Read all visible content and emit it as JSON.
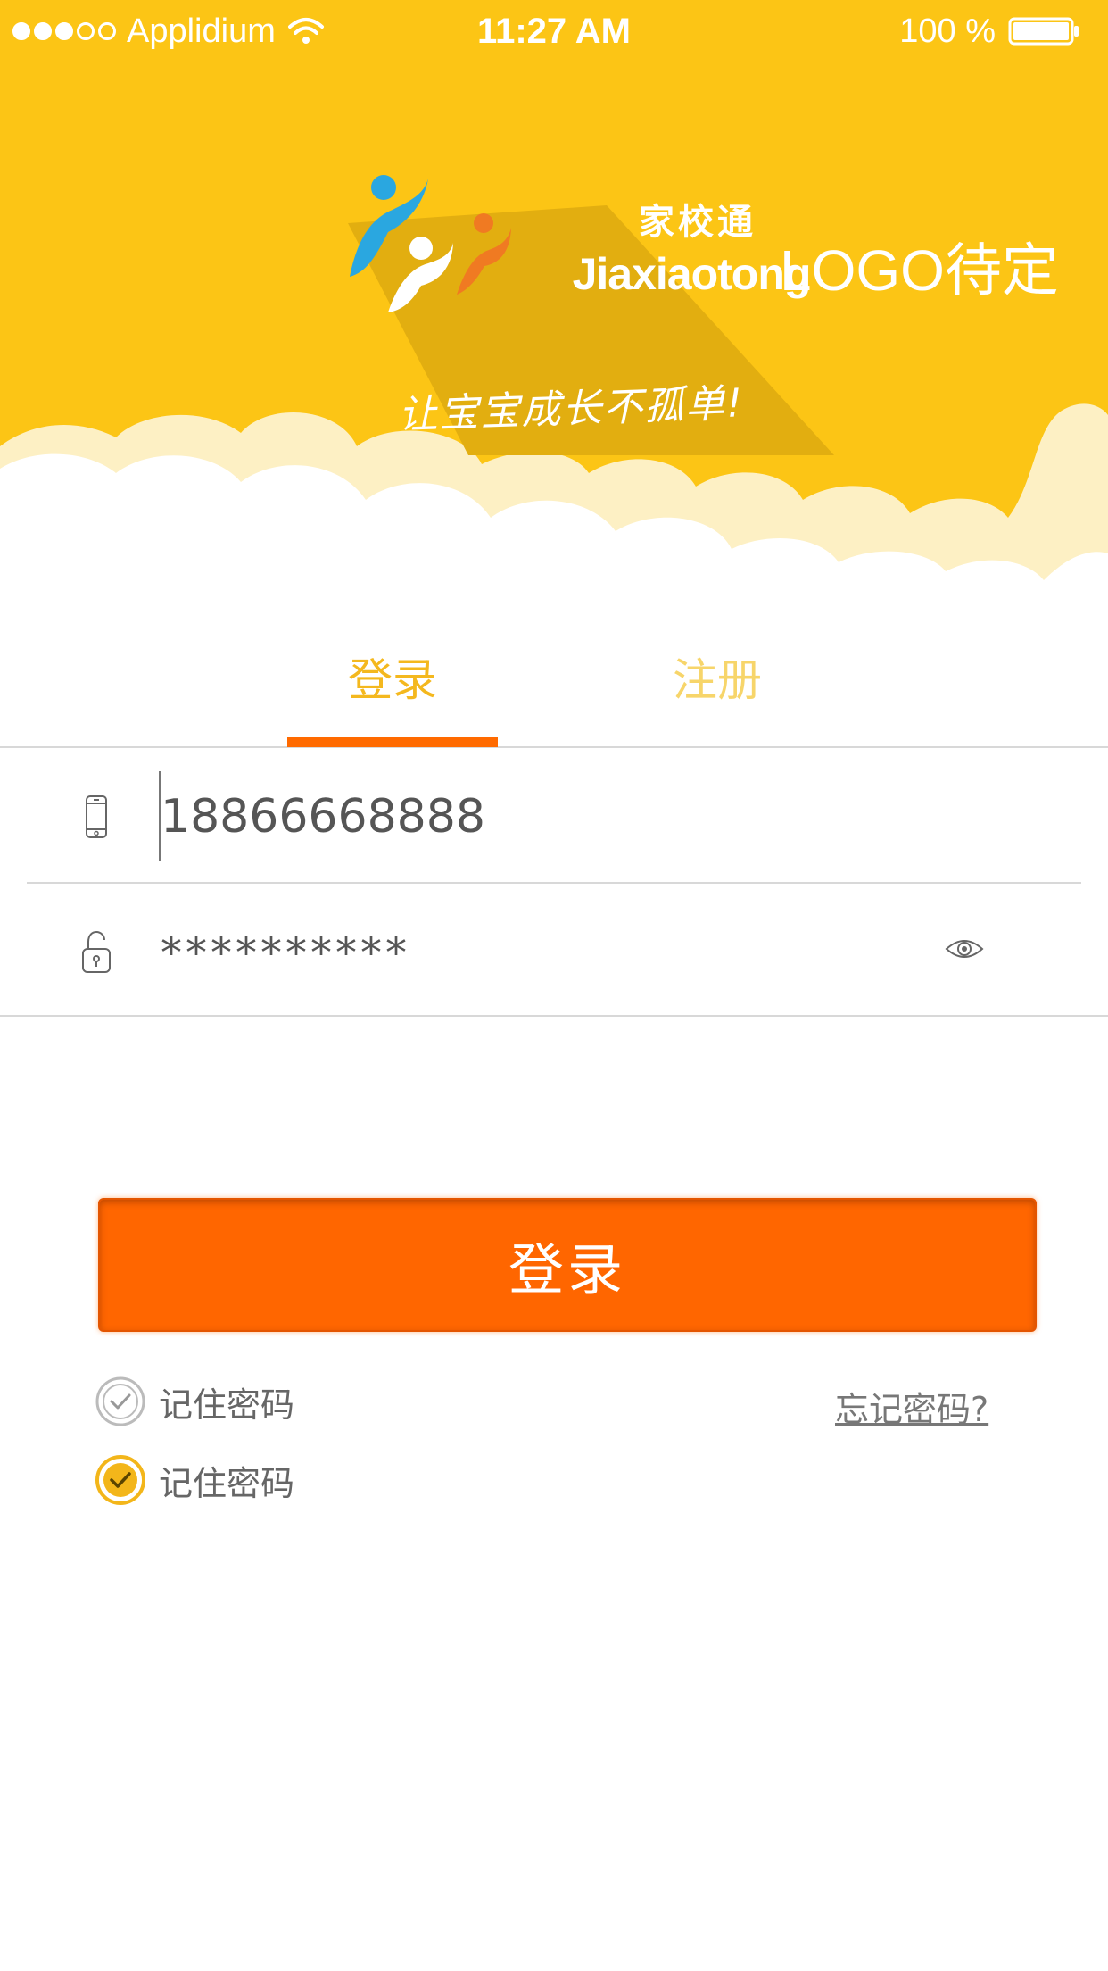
{
  "status_bar": {
    "carrier": "Applidium",
    "time": "11:27 AM",
    "battery": "100 %"
  },
  "logo": {
    "name_cn": "家校通",
    "name_en": "Jiaxiaotong",
    "slogan": "让宝宝成长不孤单!",
    "pending_label": "LOGO待定"
  },
  "tabs": {
    "login": "登录",
    "register": "注册"
  },
  "form": {
    "phone_value": "18866668888",
    "password_value": "**********"
  },
  "login_button": "登录",
  "remember": {
    "unchecked_label": "记住密码",
    "checked_label": "记住密码"
  },
  "forgot_password": "忘记密码?",
  "icons": [
    "wifi-icon",
    "battery-icon",
    "phone-icon",
    "lock-icon",
    "eye-icon",
    "checkbox-unchecked-icon",
    "checkbox-checked-icon"
  ],
  "colors": {
    "header_yellow": "#fcc515",
    "accent_orange": "#ff6600",
    "tab_active": "#f4b81e",
    "tab_inactive": "#f7d56a",
    "check_active": "#f3b61a"
  }
}
